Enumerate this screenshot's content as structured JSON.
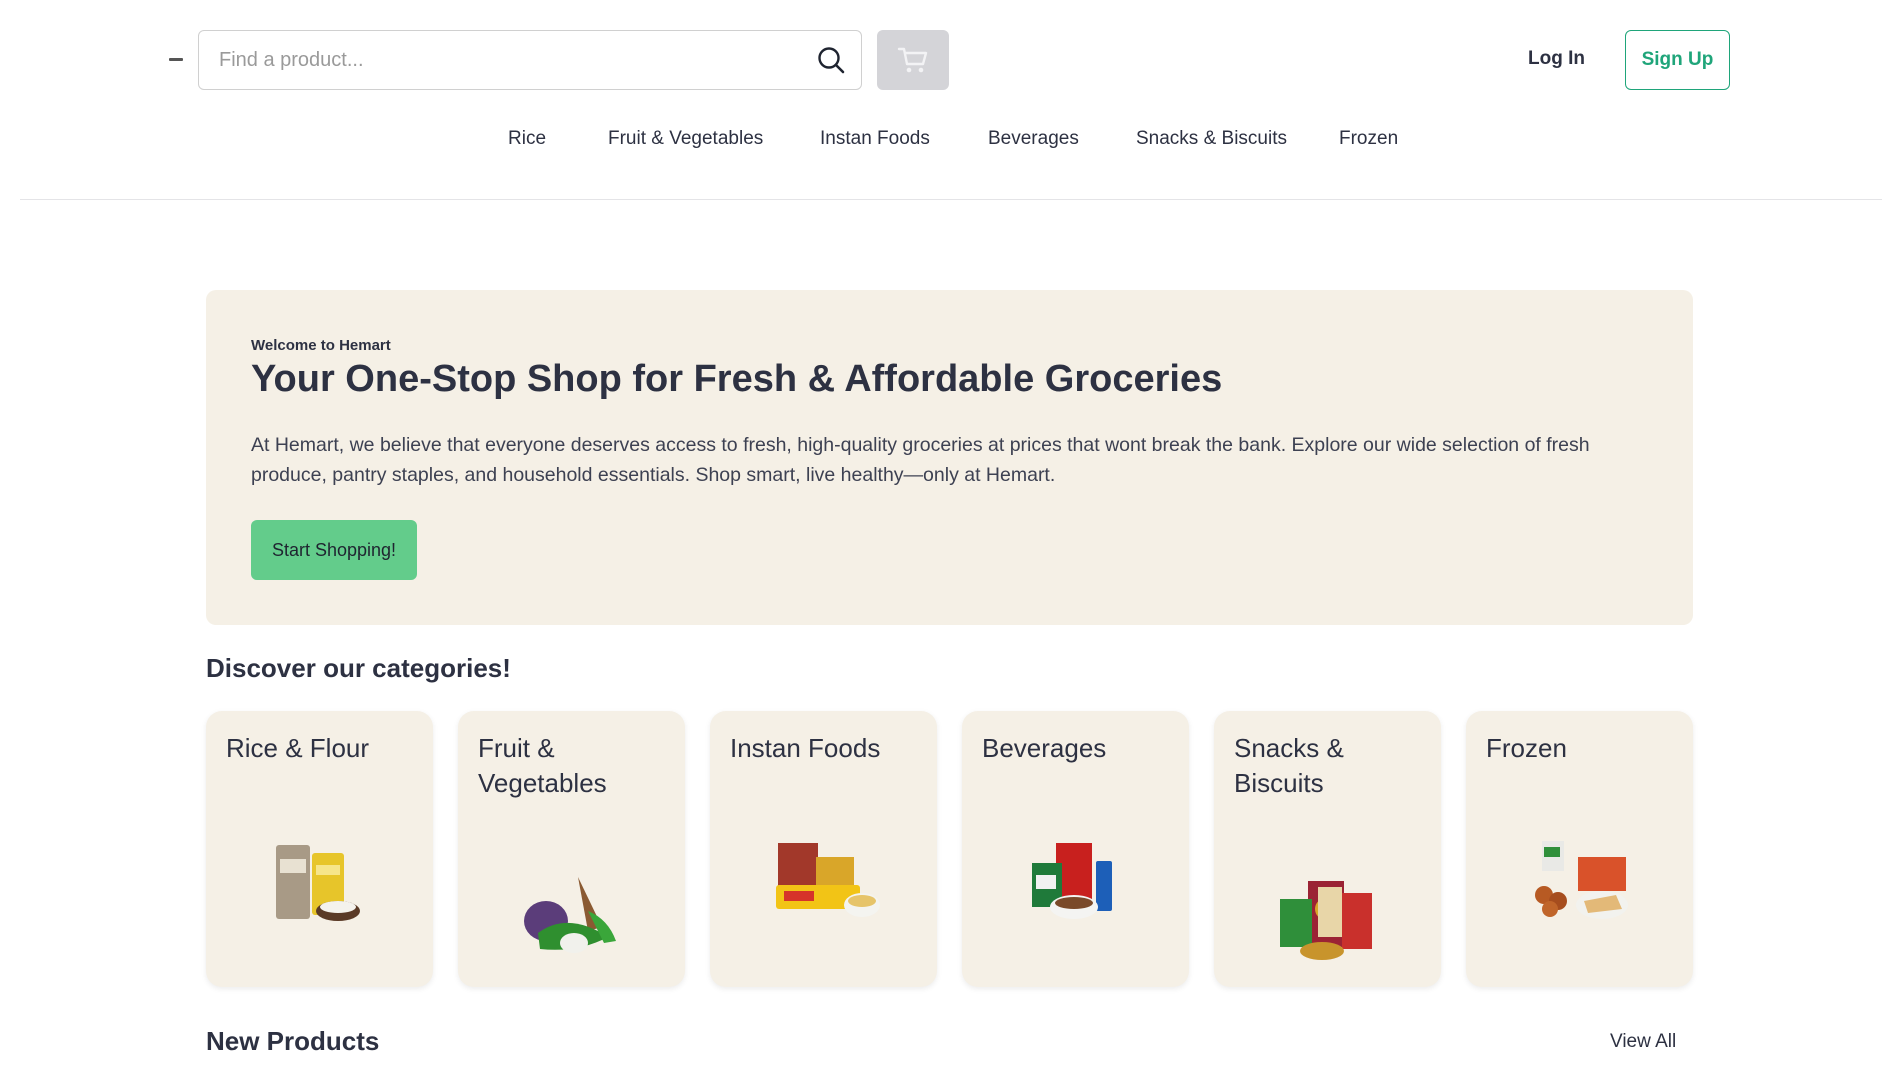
{
  "search": {
    "placeholder": "Find a product..."
  },
  "header": {
    "login_label": "Log In",
    "signup_label": "Sign Up"
  },
  "nav": {
    "items": [
      "Rice",
      "Fruit & Vegetables",
      "Instan Foods",
      "Beverages",
      "Snacks & Biscuits",
      "Frozen"
    ]
  },
  "hero": {
    "eyebrow": "Welcome to Hemart",
    "title": "Your One-Stop Shop for Fresh & Affordable Groceries",
    "text": "At Hemart, we believe that everyone deserves access to fresh, high-quality groceries at prices that wont break the bank. Explore our wide selection of fresh produce, pantry staples, and household essentials. Shop smart, live healthy—only at Hemart.",
    "cta_label": "Start Shopping!"
  },
  "categories": {
    "heading": "Discover our categories!",
    "items": [
      "Rice & Flour",
      "Fruit & Vegetables",
      "Instan Foods",
      "Beverages",
      "Snacks & Biscuits",
      "Frozen"
    ]
  },
  "new_products": {
    "heading": "New Products",
    "view_all_label": "View All"
  },
  "colors": {
    "brand_green": "#1fa57a",
    "cta_green": "#63cc8b",
    "card_bg": "#f5f0e6",
    "text_dark": "#2d3142"
  },
  "icons": {
    "search": "search-icon",
    "cart": "cart-icon"
  }
}
